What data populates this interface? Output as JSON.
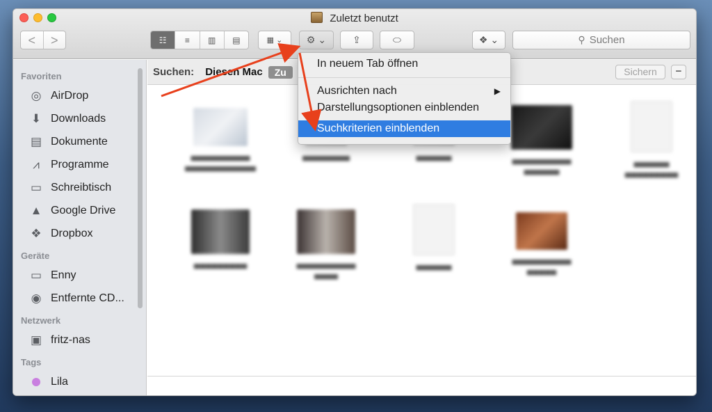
{
  "window": {
    "title": "Zuletzt benutzt"
  },
  "toolbar": {
    "back": "<",
    "forward": ">",
    "view_icon": "☷",
    "list_icon": "≡",
    "column_icon": "▥",
    "cover_icon": "▤",
    "arrange_icon": "▦ ⌄",
    "action_icon": "⚙ ⌄",
    "share_icon": "⇪",
    "tag_icon": "⬭",
    "dropbox_icon": "❖ ⌄",
    "search_placeholder": "Suchen"
  },
  "sidebar": {
    "sections": [
      {
        "header": "Favoriten",
        "items": [
          {
            "label": "AirDrop",
            "icon": "airdrop-icon",
            "glyph": "◎"
          },
          {
            "label": "Downloads",
            "icon": "downloads-icon",
            "glyph": "⬇"
          },
          {
            "label": "Dokumente",
            "icon": "documents-icon",
            "glyph": "▤"
          },
          {
            "label": "Programme",
            "icon": "applications-icon",
            "glyph": "⩘"
          },
          {
            "label": "Schreibtisch",
            "icon": "desktop-icon",
            "glyph": "▭"
          },
          {
            "label": "Google Drive",
            "icon": "google-drive-icon",
            "glyph": "▲"
          },
          {
            "label": "Dropbox",
            "icon": "dropbox-icon",
            "glyph": "❖"
          }
        ]
      },
      {
        "header": "Geräte",
        "items": [
          {
            "label": "Enny",
            "icon": "laptop-icon",
            "glyph": "▭"
          },
          {
            "label": "Entfernte CD...",
            "icon": "disc-icon",
            "glyph": "◉"
          }
        ]
      },
      {
        "header": "Netzwerk",
        "items": [
          {
            "label": "fritz-nas",
            "icon": "network-computer-icon",
            "glyph": "▣"
          }
        ]
      },
      {
        "header": "Tags",
        "items": [
          {
            "label": "Lila",
            "icon": "tag-purple-icon",
            "glyph": ""
          }
        ]
      }
    ]
  },
  "searchbar": {
    "label": "Suchen:",
    "scope_this_mac": "Diesen Mac",
    "scope_selected": "Zu",
    "save": "Sichern",
    "remove": "−"
  },
  "context_menu": {
    "items": [
      {
        "label": "In neuem Tab öffnen"
      },
      {
        "label": "Ausrichten nach",
        "submenu": "▶"
      },
      {
        "label": "Darstellungsoptionen einblenden"
      },
      {
        "label": "Suchkriterien einblenden",
        "highlighted": true
      }
    ]
  },
  "colors": {
    "menu_highlight": "#2f7de1",
    "annotation_arrow": "#e8401c"
  }
}
